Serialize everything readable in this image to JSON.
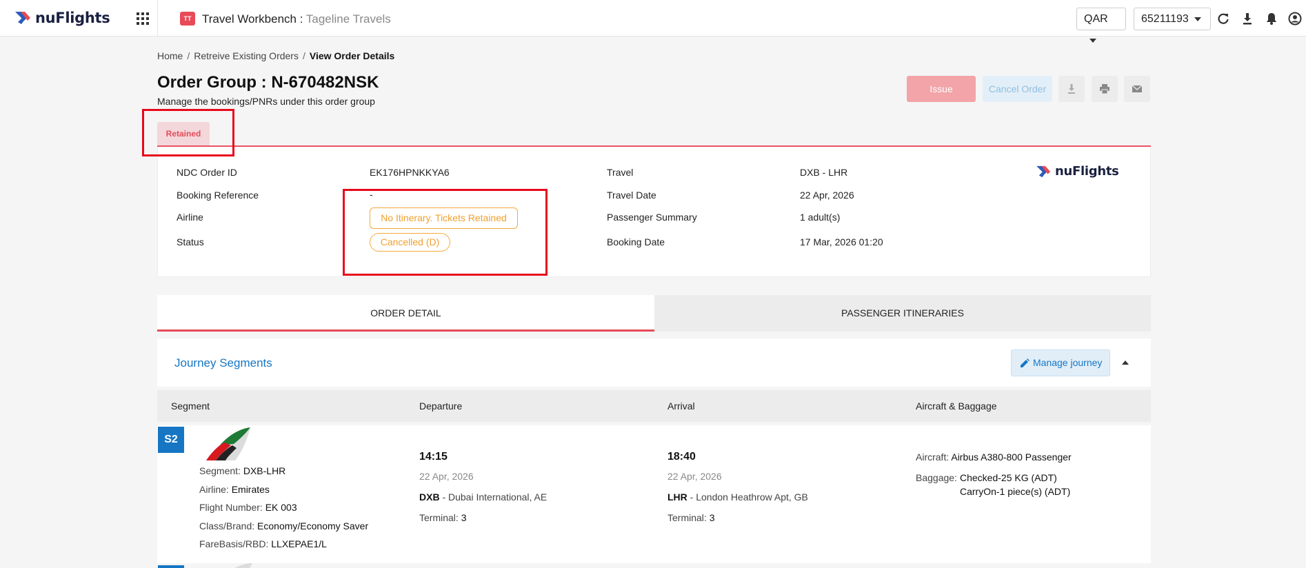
{
  "topbar": {
    "brand": "nuFlights",
    "workbench_icon": "TT",
    "workbench_title": "Travel Workbench :",
    "workbench_sub": "Tageline Travels",
    "currency": "QAR",
    "account": "65211193",
    "icons": [
      "apps-grid-icon",
      "refresh-icon",
      "download-icon",
      "bell-icon",
      "user-icon"
    ]
  },
  "breadcrumb": {
    "home": "Home",
    "sep1": "/",
    "retrieve": "Retreive Existing Orders",
    "sep2": "/",
    "current": "View Order Details"
  },
  "header": {
    "title": "Order Group : N-670482NSK",
    "subtitle": "Manage the bookings/PNRs under this order group",
    "issue_label": "Issue",
    "cancel_label": "Cancel Order"
  },
  "retained_tab": "Retained",
  "info": {
    "ndc_label": "NDC Order ID",
    "ndc_value": "EK176HPNKKYA6",
    "booking_ref_label": "Booking Reference",
    "booking_ref_value": "-",
    "airline_label": "Airline",
    "airline_value": "No Itinerary. Tickets Retained",
    "status_label": "Status",
    "status_value": "Cancelled (D)",
    "travel_label": "Travel",
    "travel_value": "DXB - LHR",
    "travel_date_label": "Travel Date",
    "travel_date_value": "22 Apr, 2026",
    "pax_label": "Passenger Summary",
    "pax_value": "1 adult(s)",
    "booking_date_label": "Booking Date",
    "booking_date_value": "17 Mar, 2026 01:20",
    "brand": "nuFlights"
  },
  "tabs": {
    "order_detail": "ORDER DETAIL",
    "passenger_itineraries": "PASSENGER ITINERARIES"
  },
  "journey": {
    "title": "Journey Segments",
    "manage_label": "Manage journey",
    "columns": [
      "Segment",
      "Departure",
      "Arrival",
      "Aircraft & Baggage"
    ]
  },
  "segment": {
    "badge": "S2",
    "segment_label": "Segment:",
    "segment_value": "DXB-LHR",
    "airline_label": "Airline:",
    "airline_value": "Emirates",
    "flight_label": "Flight Number:",
    "flight_value": "EK 003",
    "class_label": "Class/Brand:",
    "class_value": "Economy/Economy Saver",
    "farebasis_label": "FareBasis/RBD:",
    "farebasis_value": "LLXEPAE1/L",
    "dep_time": "14:15",
    "dep_date": "22 Apr, 2026",
    "dep_code": "DXB",
    "dep_airport": " - Dubai International, AE",
    "dep_terminal_label": "Terminal:",
    "dep_terminal": "3",
    "arr_time": "18:40",
    "arr_date": "22 Apr, 2026",
    "arr_code": "LHR",
    "arr_airport": " - London Heathrow Apt, GB",
    "arr_terminal_label": "Terminal:",
    "arr_terminal": "3",
    "aircraft_label": "Aircraft:",
    "aircraft_value": "Airbus A380-800 Passenger",
    "baggage_label": "Baggage:",
    "baggage_checked": "Checked-25 KG (ADT)",
    "baggage_carryon": "CarryOn-1 piece(s) (ADT)"
  },
  "colors": {
    "accent_red": "#e84a57",
    "link_blue": "#1676c4",
    "warning_orange": "#f0a02e"
  }
}
